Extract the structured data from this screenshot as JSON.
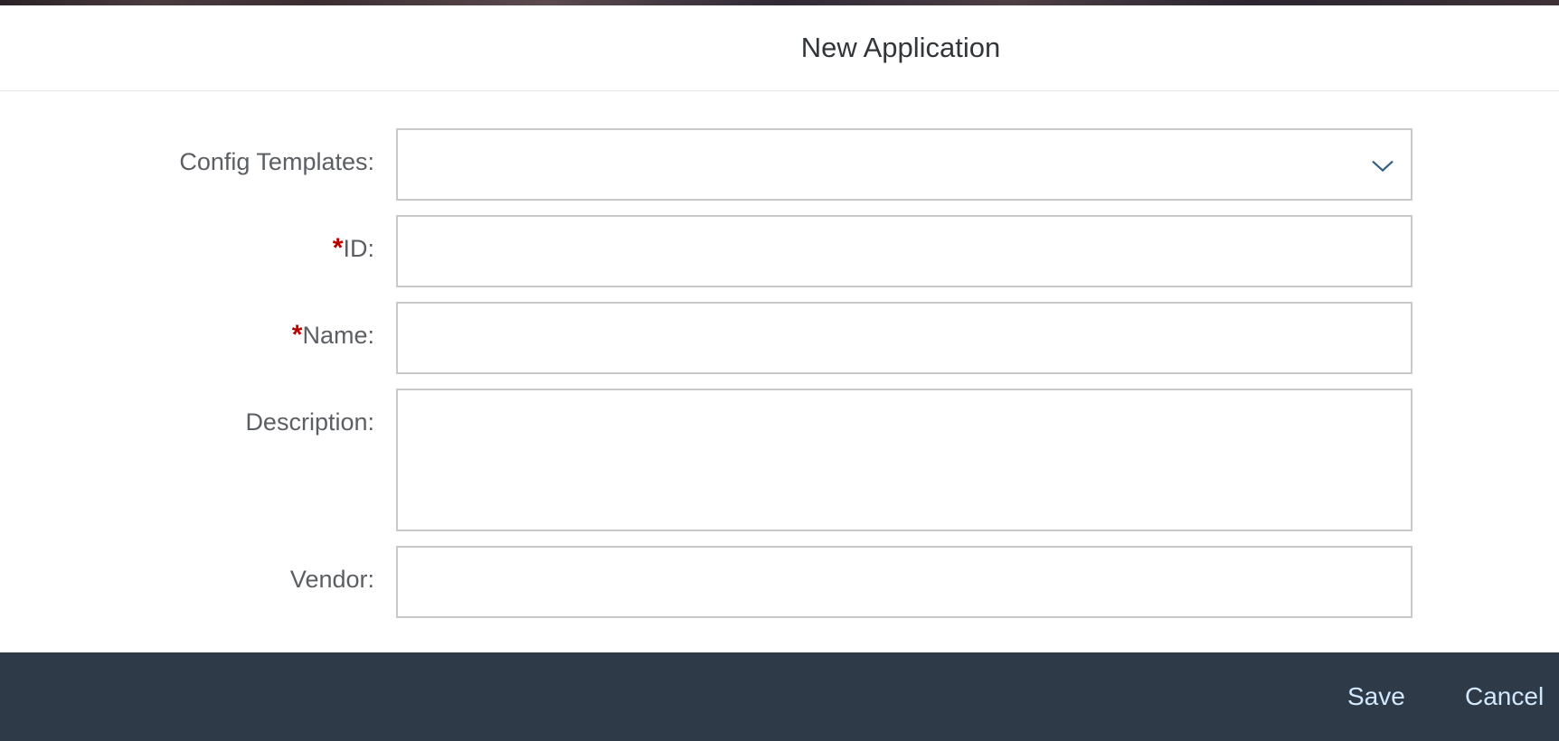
{
  "dialog": {
    "title": "New Application"
  },
  "form": {
    "config_templates": {
      "label": "Config Templates:",
      "value": ""
    },
    "id": {
      "required_mark": "*",
      "label": "ID:",
      "value": ""
    },
    "name": {
      "required_mark": "*",
      "label": "Name:",
      "value": ""
    },
    "description": {
      "label": "Description:",
      "value": ""
    },
    "vendor": {
      "label": "Vendor:",
      "value": ""
    }
  },
  "footer": {
    "save_label": "Save",
    "cancel_label": "Cancel"
  },
  "colors": {
    "footer_bg": "#2e3a47",
    "footer_text": "#d1e8ff",
    "required": "#bb0000",
    "chevron": "#346187"
  },
  "icons": {
    "dropdown": "chevron-down-icon"
  }
}
